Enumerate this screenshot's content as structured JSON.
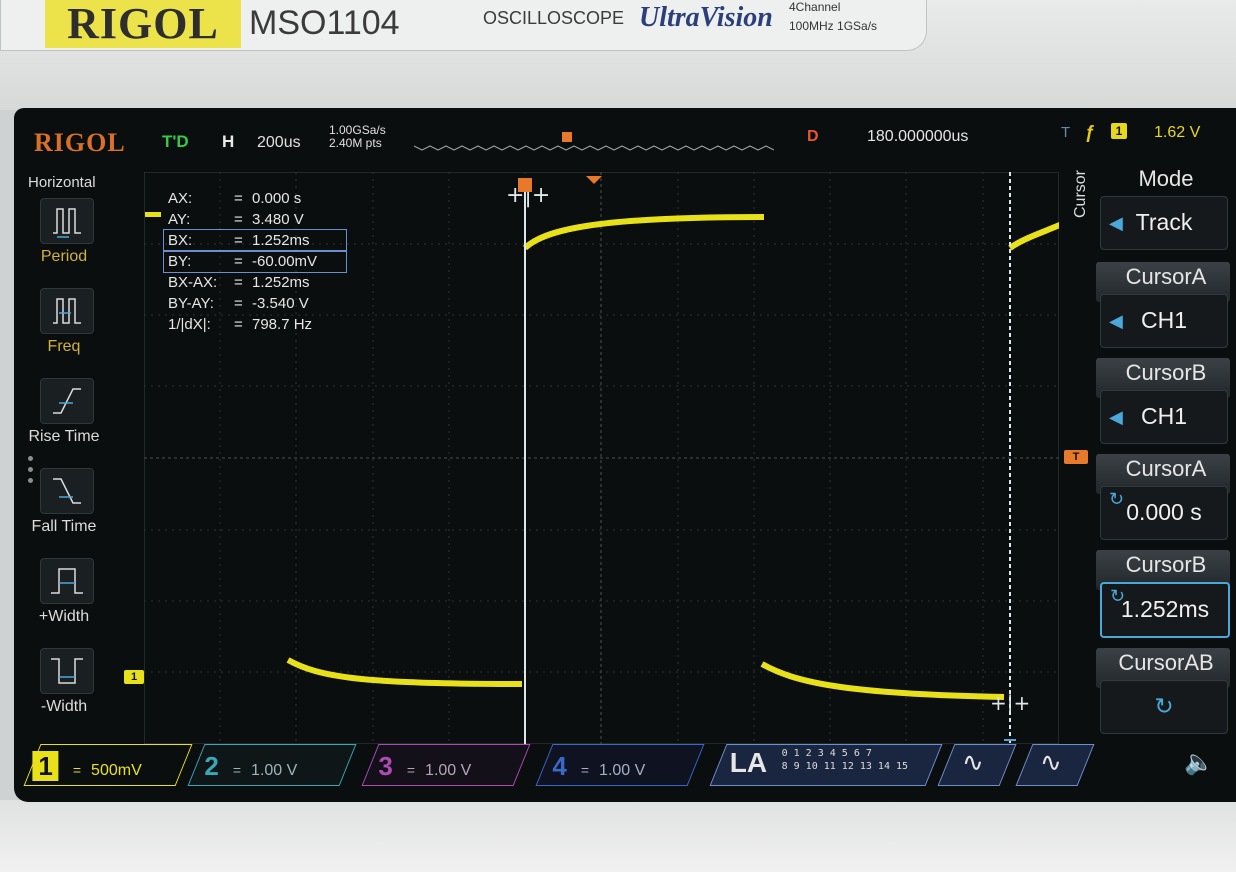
{
  "bezel": {
    "brand": "RIGOL",
    "model": "MSO1104",
    "type": "OSCILLOSCOPE",
    "series": "UltraVision",
    "channels": "4Channel",
    "spec": "100MHz  1GSa/s"
  },
  "status_bar": {
    "logo": "RIGOL",
    "trigger_status": "T'D",
    "horizontal_label": "H",
    "timebase": "200us",
    "sample_rate": "1.00GSa/s",
    "memory_depth": "2.40M pts",
    "delay_label": "D",
    "delay_value": "180.000000us",
    "trigger_label": "T",
    "trigger_edge": "ƒ",
    "trigger_source": "1",
    "trigger_level": "1.62 V"
  },
  "left_menu": {
    "title": "Horizontal",
    "items": [
      {
        "label": "Period"
      },
      {
        "label": "Freq"
      },
      {
        "label": "Rise Time"
      },
      {
        "label": "Fall Time"
      },
      {
        "label": "+Width"
      },
      {
        "label": "-Width"
      }
    ]
  },
  "readout": [
    {
      "label": "AX:",
      "value": "0.000 s"
    },
    {
      "label": "AY:",
      "value": "3.480 V"
    },
    {
      "label": "BX:",
      "value": "1.252ms"
    },
    {
      "label": "BY:",
      "value": "-60.00mV"
    },
    {
      "label": "BX-AX:",
      "value": "1.252ms"
    },
    {
      "label": "BY-AY:",
      "value": "-3.540 V"
    },
    {
      "label": "1/|dX|:",
      "value": "798.7 Hz"
    }
  ],
  "readout_eq": "=",
  "right_menu": {
    "side_label": "Cursor",
    "mode_title": "Mode",
    "mode_value": "Track",
    "cursor_a_title": "CursorA",
    "cursor_a_source": "CH1",
    "cursor_b_title": "CursorB",
    "cursor_b_source": "CH1",
    "cursor_a_pos_title": "CursorA",
    "cursor_a_pos": "0.000 s",
    "cursor_b_pos_title": "CursorB",
    "cursor_b_pos": "1.252ms",
    "cursor_ab_title": "CursorAB"
  },
  "channels": [
    {
      "num": "1",
      "coupling": "=",
      "scale": "500mV"
    },
    {
      "num": "2",
      "coupling": "=",
      "scale": "1.00 V"
    },
    {
      "num": "3",
      "coupling": "=",
      "scale": "1.00 V"
    },
    {
      "num": "4",
      "coupling": "=",
      "scale": "1.00 V"
    }
  ],
  "la": {
    "label": "LA",
    "row1": "0 1 2 3  4 5 6 7",
    "row2": "8 9 10 11  12 13 14 15"
  },
  "ch1_marker": "1",
  "trigger_marker": "T",
  "colors": {
    "ch1": "#e8e11a",
    "ch2": "#3aa7b8",
    "ch3": "#b04ab8",
    "ch4": "#3a68c8",
    "accent": "#4aa9d9",
    "logo": "#d9702a"
  },
  "icons": {
    "speaker": "🔈"
  }
}
